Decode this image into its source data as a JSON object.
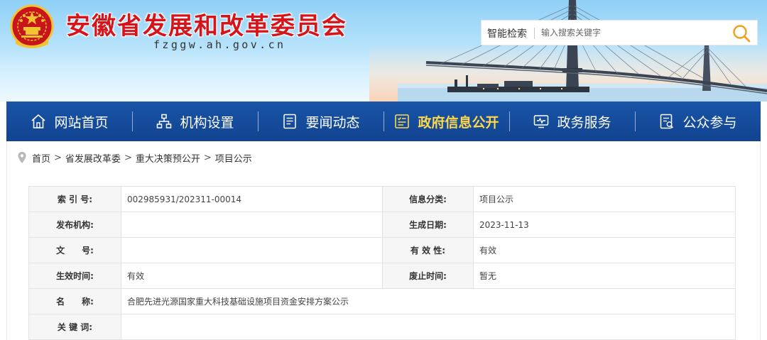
{
  "header": {
    "title": "安徽省发展和改革委员会",
    "domain": "fzggw.ah.gov.cn"
  },
  "search": {
    "label": "智能检索",
    "placeholder": "输入搜索关键字"
  },
  "nav": {
    "items": [
      {
        "label": "网站首页",
        "icon": "home-icon"
      },
      {
        "label": "机构设置",
        "icon": "org-chart-icon"
      },
      {
        "label": "要闻动态",
        "icon": "news-icon"
      },
      {
        "label": "政府信息公开",
        "icon": "info-disclosure-icon",
        "active": true
      },
      {
        "label": "政务服务",
        "icon": "monitor-service-icon"
      },
      {
        "label": "公众参与",
        "icon": "participation-icon"
      }
    ]
  },
  "breadcrumb": {
    "items": [
      "首页",
      "省发展改革委",
      "重大决策预公开",
      "项目公示"
    ],
    "separator": ">"
  },
  "info": {
    "index_label": "索 引 号:",
    "index_value": "002985931/202311-00014",
    "category_label": "信息分类:",
    "category_value": "项目公示",
    "publisher_label": "发布机构:",
    "publisher_value": "",
    "date_label": "生成日期:",
    "date_value": "2023-11-13",
    "docno_label": "文　　号:",
    "docno_value": "",
    "validity_label": "有 效 性:",
    "validity_value": "有效",
    "effective_label": "生效时间:",
    "effective_value": "有效",
    "expiry_label": "废止时间:",
    "expiry_value": "暂无",
    "name_label": "名　　称:",
    "name_value": "合肥先进光源国家重大科技基础设施项目资金安排方案公示",
    "keywords_label": "关 键 词:",
    "keywords_value": ""
  },
  "colors": {
    "brand_red": "#d5151b",
    "nav_blue": "#1a55a8",
    "nav_active": "#ffd84a",
    "search_icon": "#f0a020"
  }
}
